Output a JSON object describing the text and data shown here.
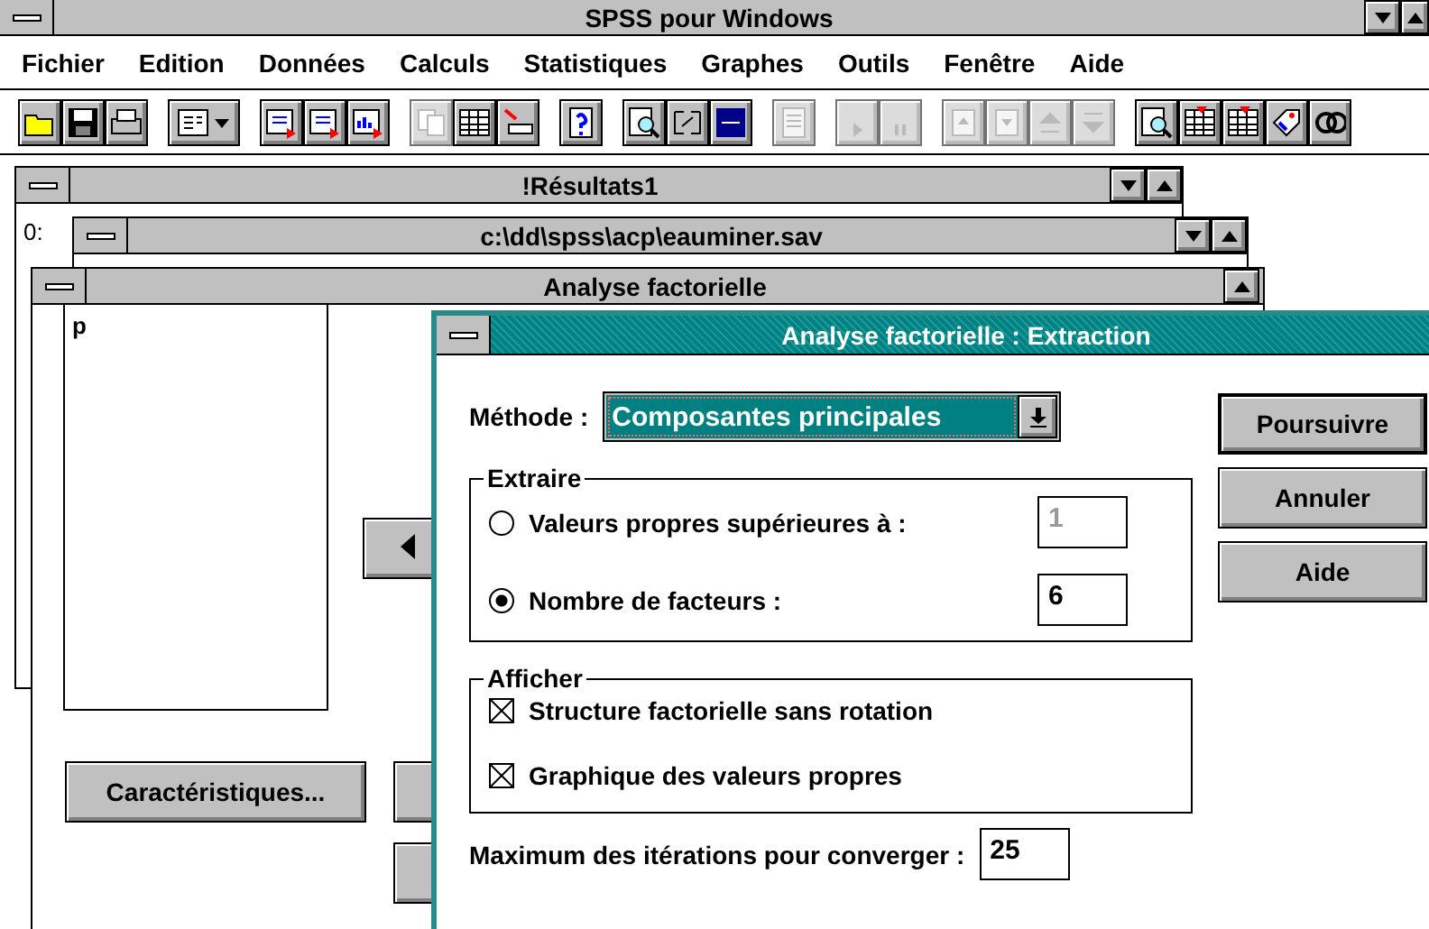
{
  "app": {
    "title": "SPSS pour Windows"
  },
  "menu": [
    "Fichier",
    "Edition",
    "Données",
    "Calculs",
    "Statistiques",
    "Graphes",
    "Outils",
    "Fenêtre",
    "Aide"
  ],
  "toolbar": [
    {
      "buttons": [
        {
          "kind": "folder",
          "disabled": false
        },
        {
          "kind": "floppy",
          "disabled": false
        },
        {
          "kind": "printer",
          "disabled": false
        }
      ]
    },
    {
      "buttons": [
        {
          "kind": "layout",
          "disabled": false
        }
      ]
    },
    {
      "buttons": [
        {
          "kind": "doc",
          "disabled": false
        },
        {
          "kind": "doc",
          "disabled": false
        },
        {
          "kind": "chart",
          "disabled": false
        }
      ]
    },
    {
      "buttons": [
        {
          "kind": "copy",
          "disabled": true
        },
        {
          "kind": "grid",
          "disabled": false
        },
        {
          "kind": "insert",
          "disabled": false
        }
      ]
    },
    {
      "buttons": [
        {
          "kind": "help",
          "disabled": false
        }
      ]
    },
    {
      "buttons": [
        {
          "kind": "find",
          "disabled": false
        },
        {
          "kind": "tags",
          "disabled": false
        },
        {
          "kind": "az",
          "disabled": false
        }
      ]
    },
    {
      "buttons": [
        {
          "kind": "report",
          "disabled": true
        }
      ]
    },
    {
      "buttons": [
        {
          "kind": "play",
          "disabled": true
        },
        {
          "kind": "pause",
          "disabled": true
        }
      ]
    },
    {
      "buttons": [
        {
          "kind": "pageup",
          "disabled": true
        },
        {
          "kind": "pagedown",
          "disabled": true
        },
        {
          "kind": "up",
          "disabled": true
        },
        {
          "kind": "down",
          "disabled": true
        }
      ]
    },
    {
      "buttons": [
        {
          "kind": "find",
          "disabled": false
        },
        {
          "kind": "table",
          "disabled": false
        },
        {
          "kind": "table",
          "disabled": false
        },
        {
          "kind": "tag",
          "disabled": false
        },
        {
          "kind": "circles",
          "disabled": false
        }
      ]
    }
  ],
  "results_window": {
    "title": "!Résultats1",
    "output": "0:"
  },
  "data_window": {
    "title": "c:\\dd\\spss\\acp\\eauminer.sav"
  },
  "factor_dialog": {
    "title": "Analyse factorielle",
    "variables": [
      "p"
    ],
    "buttons": [
      "Caractéristiques..."
    ]
  },
  "extraction_dialog": {
    "title": "Analyse factorielle : Extraction",
    "method": {
      "label": "Méthode :",
      "value": "Composantes principales"
    },
    "extract": {
      "title": "Extraire",
      "options": [
        {
          "label": "Valeurs propres supérieures à :",
          "selected": false,
          "value": "1"
        },
        {
          "label": "Nombre de facteurs :",
          "selected": true,
          "value": "6"
        }
      ]
    },
    "display": {
      "title": "Afficher",
      "options": [
        {
          "label": "Structure factorielle sans rotation",
          "checked": true
        },
        {
          "label": "Graphique des valeurs propres",
          "checked": true
        }
      ]
    },
    "iterations": {
      "label": "Maximum des itérations pour converger :",
      "value": "25"
    },
    "buttons": [
      {
        "label": "Poursuivre",
        "default": true
      },
      {
        "label": "Annuler",
        "default": false
      },
      {
        "label": "Aide",
        "default": false
      }
    ]
  }
}
